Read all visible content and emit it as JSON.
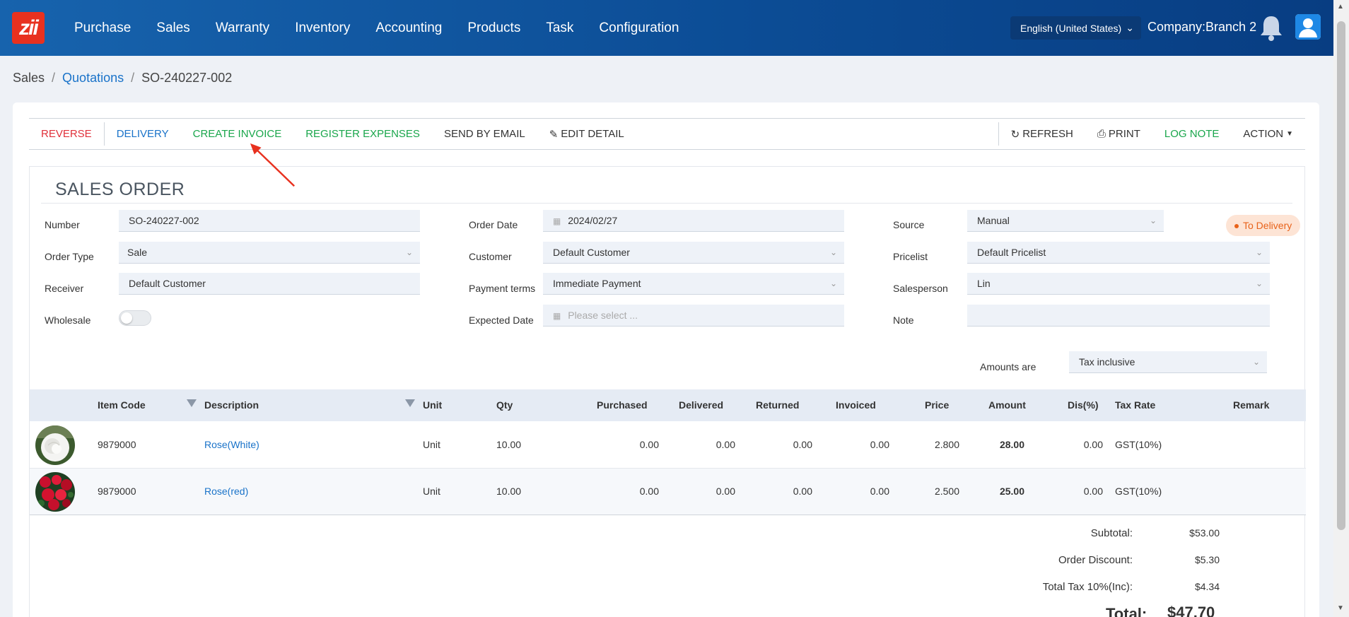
{
  "brand": {
    "logo_text": "zii",
    "accent": "#e8311f",
    "nav_bg": "#0c4d96"
  },
  "nav": {
    "items": [
      "Purchase",
      "Sales",
      "Warranty",
      "Inventory",
      "Accounting",
      "Products",
      "Task",
      "Configuration"
    ]
  },
  "header": {
    "language": "English (United States)",
    "company": "Company:Branch 2",
    "bell_icon": "bell-icon",
    "user_icon": "user-avatar-icon"
  },
  "breadcrumb": {
    "root": "Sales",
    "parent": "Quotations",
    "current": "SO-240227-002",
    "sep": "/"
  },
  "toolbar": {
    "reverse": "REVERSE",
    "delivery": "DELIVERY",
    "create_invoice": "CREATE INVOICE",
    "register_expenses": "REGISTER EXPENSES",
    "send_by_email": "SEND BY EMAIL",
    "edit_detail": "EDIT DETAIL",
    "refresh": "REFRESH",
    "print": "PRINT",
    "log_note": "LOG NOTE",
    "action": "ACTION"
  },
  "form": {
    "title": "SALES ORDER",
    "status": "To Delivery",
    "labels": {
      "number": "Number",
      "order_type": "Order Type",
      "receiver": "Receiver",
      "wholesale": "Wholesale",
      "order_date": "Order Date",
      "customer": "Customer",
      "payment_terms": "Payment terms",
      "expected_date": "Expected Date",
      "source": "Source",
      "pricelist": "Pricelist",
      "salesperson": "Salesperson",
      "note": "Note",
      "amounts_are": "Amounts are"
    },
    "values": {
      "number": "SO-240227-002",
      "order_type": "Sale",
      "receiver": "Default Customer",
      "wholesale": false,
      "order_date": "2024/02/27",
      "customer": "Default Customer",
      "payment_terms": "Immediate Payment",
      "expected_date_placeholder": "Please select ...",
      "source": "Manual",
      "pricelist": "Default Pricelist",
      "salesperson": "Lin",
      "note": "",
      "amounts_are": "Tax inclusive"
    }
  },
  "table": {
    "headers": {
      "item_code": "Item Code",
      "description": "Description",
      "unit": "Unit",
      "qty": "Qty",
      "purchased": "Purchased",
      "delivered": "Delivered",
      "returned": "Returned",
      "invoiced": "Invoiced",
      "price": "Price",
      "amount": "Amount",
      "dis": "Dis(%)",
      "tax_rate": "Tax Rate",
      "remark": "Remark"
    },
    "rows": [
      {
        "item_code": "9879000",
        "description": "Rose(White)",
        "unit": "Unit",
        "qty": "10.00",
        "purchased": "0.00",
        "delivered": "0.00",
        "returned": "0.00",
        "invoiced": "0.00",
        "price": "2.800",
        "amount": "28.00",
        "dis": "0.00",
        "tax_rate": "GST(10%)",
        "remark": "",
        "image": "white-rose"
      },
      {
        "item_code": "9879000",
        "description": "Rose(red)",
        "unit": "Unit",
        "qty": "10.00",
        "purchased": "0.00",
        "delivered": "0.00",
        "returned": "0.00",
        "invoiced": "0.00",
        "price": "2.500",
        "amount": "25.00",
        "dis": "0.00",
        "tax_rate": "GST(10%)",
        "remark": "",
        "image": "red-roses"
      }
    ]
  },
  "totals": {
    "subtotal_label": "Subtotal:",
    "subtotal": "$53.00",
    "discount_label": "Order Discount:",
    "discount": "$5.30",
    "tax_label": "Total Tax 10%(Inc):",
    "tax": "$4.34",
    "total_label": "Total:",
    "total": "$47.70"
  }
}
